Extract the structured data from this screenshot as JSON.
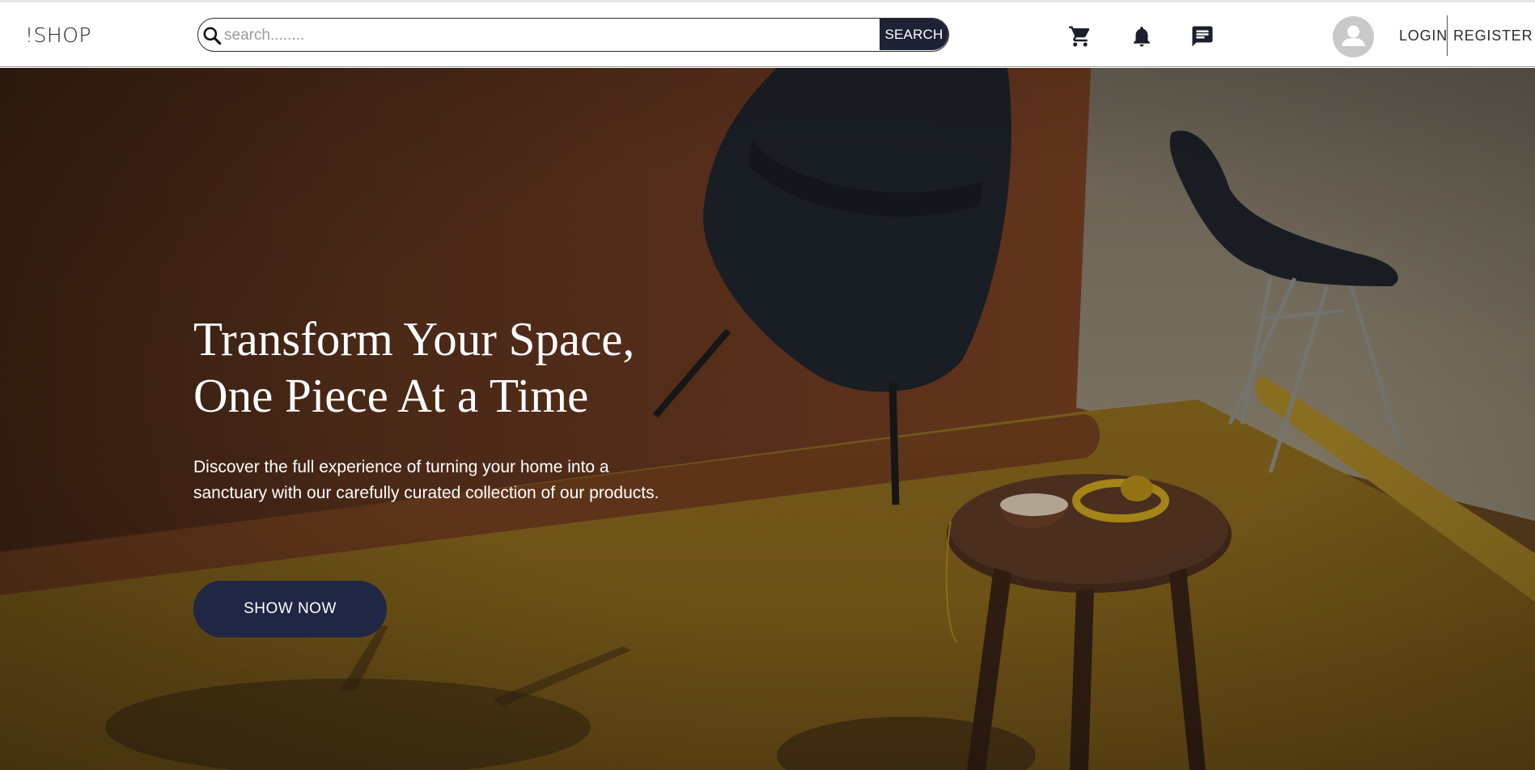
{
  "header": {
    "brand": "!SHOP",
    "search": {
      "placeholder": "search........",
      "value": "",
      "button_label": "SEARCH"
    },
    "icons": [
      "cart-icon",
      "bell-icon",
      "chat-icon",
      "user-icon"
    ],
    "auth": {
      "login_label": "LOGIN",
      "register_label": "REGISTER"
    }
  },
  "hero": {
    "title_line1": "Transform Your Space,",
    "title_line2": "One Piece At a Time",
    "description": "Discover the full experience of turning your home into a sanctuary with our carefully curated collection of our products.",
    "button_label": "SHOW NOW"
  },
  "colors": {
    "accent": "#1e2235",
    "button": "#1f2744",
    "wall_brown": "#6b3a22",
    "floor_mustard": "#8f6f22",
    "wall_beige": "#a59a86"
  }
}
